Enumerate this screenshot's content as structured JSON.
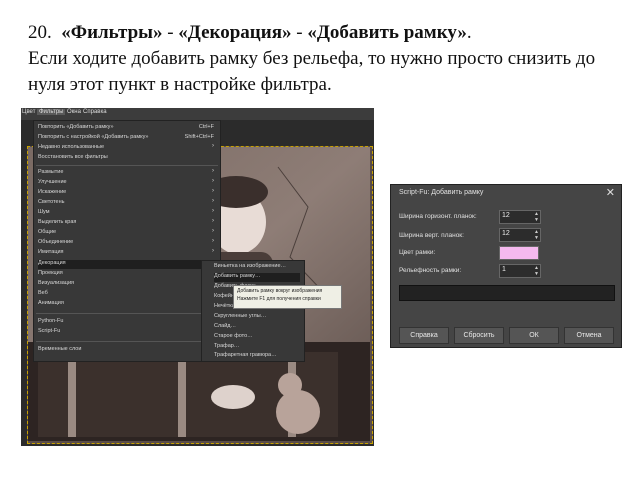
{
  "heading": {
    "number": "20.",
    "filters": "«Фильтры»",
    "sep1": "-",
    "decoration": "«Декорация»",
    "sep2": "-",
    "add_border": "«Добавить рамку»",
    "dot": ".",
    "body": "Если ходите добавить рамку без рельефа, то нужно просто снизить до нуля этот пункт в настройке фильтра."
  },
  "menubar": [
    "Цвет",
    "Фильтры",
    "Окна",
    "Справка"
  ],
  "filters_menu": {
    "items": [
      {
        "label": "Повторить «Добавить рамку»",
        "shortcut": "Ctrl+F"
      },
      {
        "label": "Повторить с настройкой «Добавить рамку»",
        "shortcut": "Shift+Ctrl+F"
      },
      {
        "label": "Недавно использованные",
        "arrow": "›"
      },
      {
        "label": "Восстановить все фильтры",
        "arrow": ""
      },
      {
        "label": "Размытие",
        "arrow": "›"
      },
      {
        "label": "Улучшение",
        "arrow": "›"
      },
      {
        "label": "Искажение",
        "arrow": "›"
      },
      {
        "label": "Светотень",
        "arrow": "›"
      },
      {
        "label": "Шум",
        "arrow": "›"
      },
      {
        "label": "Выделить края",
        "arrow": "›"
      },
      {
        "label": "Общие",
        "arrow": "›"
      },
      {
        "label": "Объединение",
        "arrow": "›"
      },
      {
        "label": "Имитация",
        "arrow": "›"
      },
      {
        "label": "Декорация",
        "arrow": "›"
      },
      {
        "label": "Проекция",
        "arrow": "›"
      },
      {
        "label": "Визуализация",
        "arrow": "›"
      },
      {
        "label": "Веб",
        "arrow": "›"
      },
      {
        "label": "Анимация",
        "arrow": "›"
      },
      {
        "label": "Python-Fu",
        "arrow": "›"
      },
      {
        "label": "Script-Fu",
        "arrow": "›"
      },
      {
        "label": "Временные слои",
        "arrow": ""
      }
    ]
  },
  "decor_submenu": {
    "items": [
      "Виньетка на изображение…",
      "Добавить рамку…",
      "Добавить фаску…",
      "Кофейные пятна…",
      "Нечёткая рамка…",
      "Скругленные углы…",
      "Слайд…",
      "Старое фото…",
      "Трафар…",
      "Трафаретная гравюра…"
    ]
  },
  "tooltip": {
    "line1": "Добавить рамку вокруг изображения",
    "line2": "Нажмите F1 для получения справки"
  },
  "dialog": {
    "title": "Script-Fu: Добавить рамку",
    "close": "✕",
    "fields": [
      {
        "label": "Ширина горизонт. планок:",
        "value": "12"
      },
      {
        "label": "Ширина верт. планок:",
        "value": "12"
      },
      {
        "label": "Цвет рамки:",
        "value": ""
      },
      {
        "label": "Рельефность рамки:",
        "value": "1"
      }
    ],
    "swatch_color": "#f5b9ef",
    "buttons": [
      "Справка",
      "Сбросить",
      "ОК",
      "Отмена"
    ]
  }
}
